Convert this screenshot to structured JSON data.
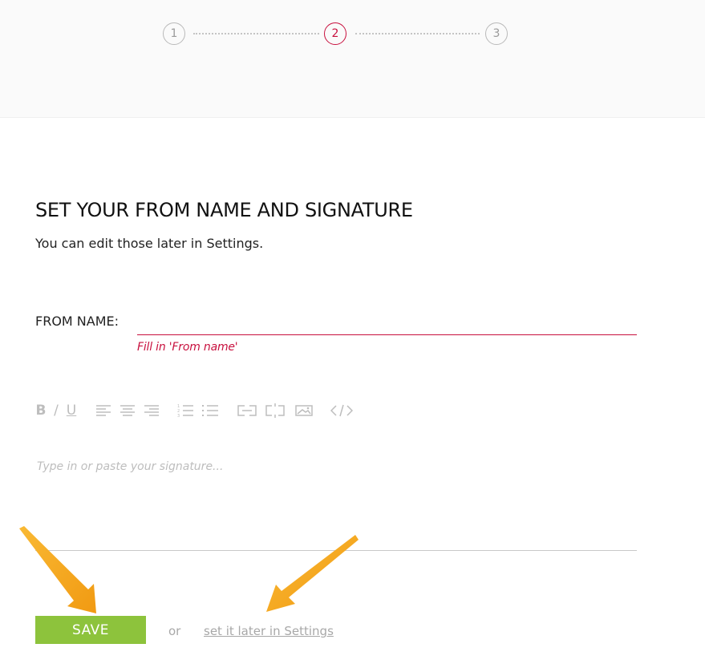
{
  "progress": {
    "steps": [
      {
        "label": "1",
        "state": "inactive"
      },
      {
        "label": "2",
        "state": "active"
      },
      {
        "label": "3",
        "state": "inactive"
      }
    ],
    "active_step": 2,
    "total_steps": 3
  },
  "heading": {
    "title": "SET YOUR FROM NAME AND SIGNATURE",
    "subtitle": "You can edit those later in Settings."
  },
  "from_name": {
    "label": "FROM NAME:",
    "value": "",
    "error": "Fill in 'From name'"
  },
  "editor": {
    "toolbar": [
      "bold-icon",
      "italic-icon",
      "underline-icon",
      "align-left-icon",
      "align-center-icon",
      "align-right-icon",
      "ordered-list-icon",
      "unordered-list-icon",
      "link-icon",
      "unlink-icon",
      "image-icon",
      "code-icon"
    ],
    "toolbar_glyphs": {
      "bold": "B",
      "italic": "/",
      "underline": "U"
    },
    "placeholder": "Type in or paste your signature..."
  },
  "actions": {
    "save_label": "SAVE",
    "or_label": "or",
    "later_link": "set it later in Settings"
  },
  "colors": {
    "accent": "#c8103e",
    "save_green": "#8dc33c",
    "annotation_arrow": "#f5a623"
  }
}
